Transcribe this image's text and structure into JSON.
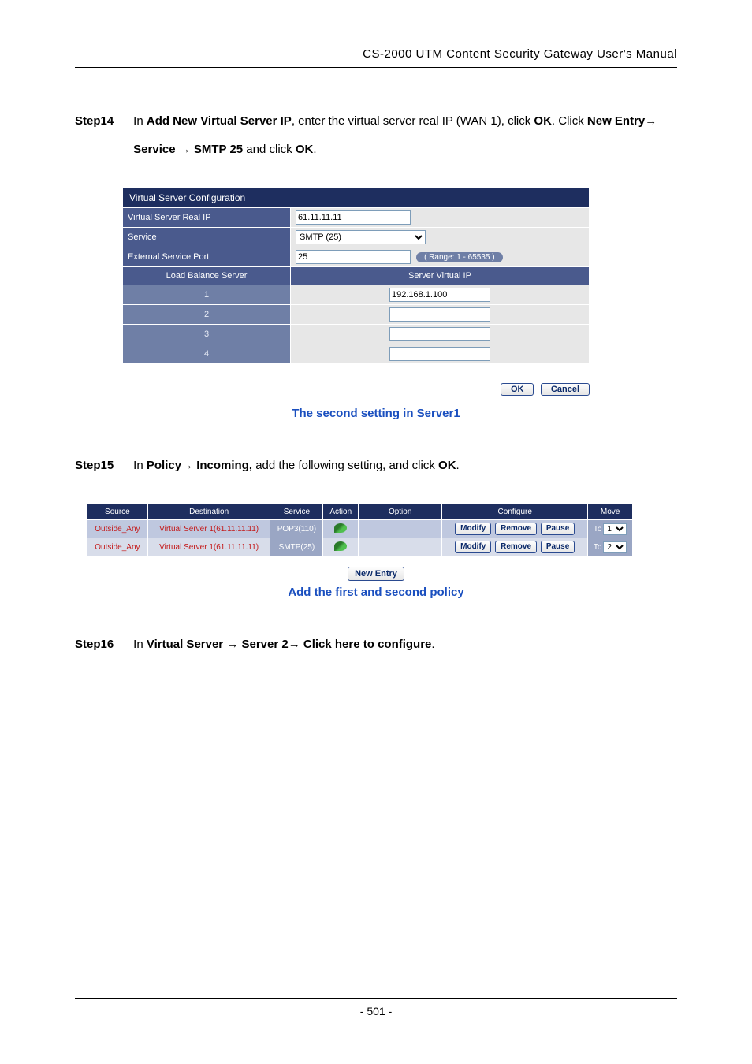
{
  "header": "CS-2000 UTM Content Security Gateway User's Manual",
  "step14": {
    "label": "Step14",
    "text_a": "In ",
    "bold_a": "Add New Virtual Server IP",
    "text_b": ", enter the virtual server real IP (WAN 1), click ",
    "bold_b": "OK",
    "text_c": ". Click ",
    "bold_c": "New Entry",
    "bold_d": " Service ",
    "bold_e": " SMTP 25",
    "text_d": " and click ",
    "bold_f": "OK",
    "text_e": "."
  },
  "vsc": {
    "title": "Virtual Server Configuration",
    "row_ip_label": "Virtual Server Real IP",
    "row_ip_value": "61.11.11.11",
    "row_service_label": "Service",
    "row_service_value": "SMTP (25)",
    "row_port_label": "External Service Port",
    "row_port_value": "25",
    "row_port_range": "( Range: 1 - 65535 )",
    "lb_head_left": "Load Balance Server",
    "lb_head_right": "Server Virtual IP",
    "rows": [
      {
        "n": "1",
        "v": "192.168.1.100"
      },
      {
        "n": "2",
        "v": ""
      },
      {
        "n": "3",
        "v": ""
      },
      {
        "n": "4",
        "v": ""
      }
    ],
    "btn_ok": "OK",
    "btn_cancel": "Cancel"
  },
  "caption1": "The second setting in Server1",
  "step15": {
    "label": "Step15",
    "text_a": "In ",
    "bold_a": "Policy",
    "bold_b": " Incoming,",
    "text_b": " add the following setting, and click ",
    "bold_c": "OK",
    "text_c": "."
  },
  "pol": {
    "headers": [
      "Source",
      "Destination",
      "Service",
      "Action",
      "Option",
      "Configure",
      "Move"
    ],
    "rows": [
      {
        "src": "Outside_Any",
        "dst": "Virtual Server 1(61.11.11.11)",
        "svc": "POP3(110)",
        "mv": "1"
      },
      {
        "src": "Outside_Any",
        "dst": "Virtual Server 1(61.11.11.11)",
        "svc": "SMTP(25)",
        "mv": "2"
      }
    ],
    "chips": {
      "modify": "Modify",
      "remove": "Remove",
      "pause": "Pause"
    },
    "move_to": "To",
    "new_entry": "New Entry"
  },
  "caption2": "Add the first and second policy",
  "step16": {
    "label": "Step16",
    "text_a": "In ",
    "bold_a": "Virtual Server ",
    "bold_b": " Server 2",
    "bold_c": " Click here to configure",
    "text_b": "."
  },
  "footer": "- 501 -"
}
